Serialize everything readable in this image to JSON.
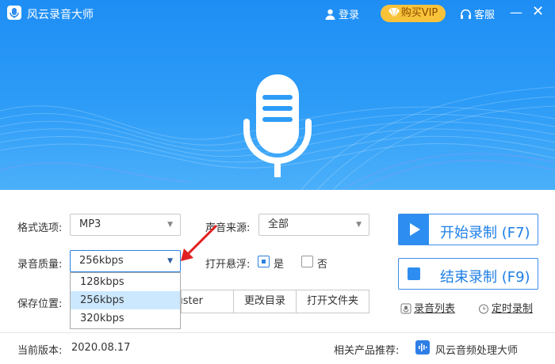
{
  "titlebar": {
    "title": "风云录音大师",
    "login_label": "登录",
    "vip_label": "购买VIP",
    "service_label": "客服",
    "minimize_glyph": "—",
    "close_glyph": "✕"
  },
  "settings": {
    "format_label": "格式选项:",
    "format_value": "MP3",
    "source_label": "声音来源:",
    "source_value": "全部",
    "quality_label": "录音质量:",
    "quality_value": "256kbps",
    "quality_options": [
      "128kbps",
      "256kbps",
      "320kbps"
    ],
    "quality_selected_index": 1,
    "float_label": "打开悬浮:",
    "float_yes": "是",
    "float_no": "否",
    "float_yes_checked": true,
    "float_no_checked": false,
    "save_label": "保存位置:",
    "save_path_tail": "uster",
    "change_dir_button": "更改目录",
    "open_folder_button": "打开文件夹"
  },
  "actions": {
    "start_label": "开始录制 (F7)",
    "stop_label": "结束录制 (F9)",
    "record_list_link": "录音列表",
    "schedule_link": "定时录制"
  },
  "footer": {
    "version_label": "当前版本:",
    "version_value": "2020.08.17",
    "related_label": "相关产品推荐:",
    "related_product": "风云音频处理大师"
  },
  "colors": {
    "header_blue": "#2d9cf7",
    "accent_blue": "#1f7fe6",
    "vip_gold": "#f8c33a",
    "dropdown_highlight": "#cce8ff",
    "annotation_red": "#e02020"
  },
  "icons": [
    "app-logo-icon",
    "user-icon",
    "diamond-icon",
    "headset-icon",
    "microphone-icon",
    "play-icon",
    "stop-icon",
    "record-list-icon",
    "clock-icon",
    "audio-app-icon",
    "arrow-pointer"
  ]
}
